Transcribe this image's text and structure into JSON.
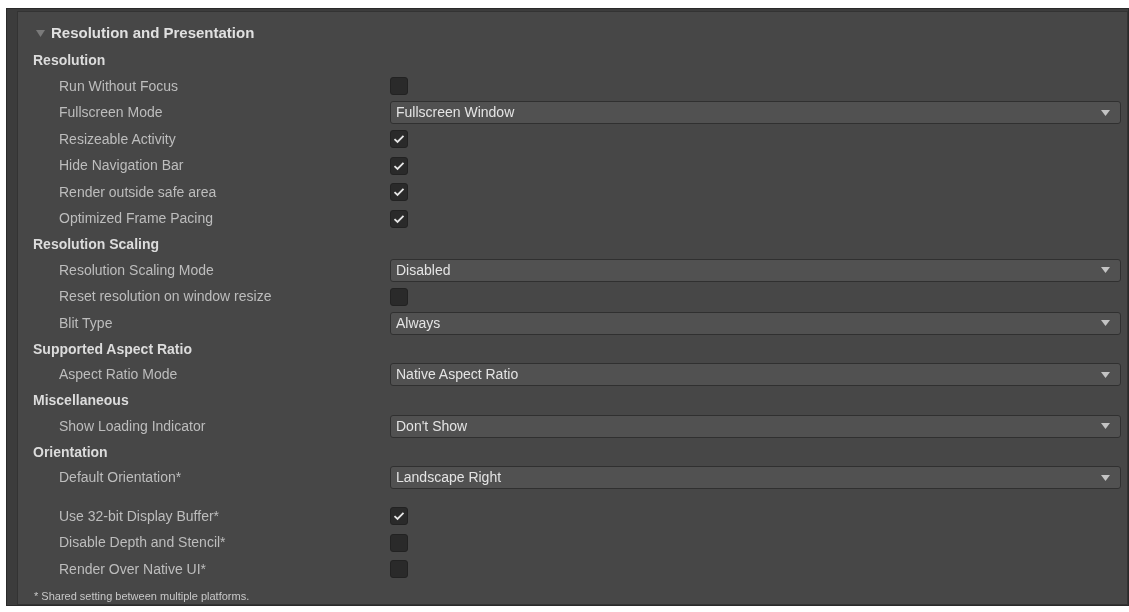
{
  "section": {
    "title": "Resolution and Presentation",
    "expanded": true
  },
  "groups": [
    {
      "title": "Resolution",
      "settings": [
        {
          "label": "Run Without Focus",
          "kind": "checkbox",
          "checked": false
        },
        {
          "label": "Fullscreen Mode",
          "kind": "dropdown",
          "value": "Fullscreen Window"
        },
        {
          "label": "Resizeable Activity",
          "kind": "checkbox",
          "checked": true
        },
        {
          "label": "Hide Navigation Bar",
          "kind": "checkbox",
          "checked": true
        },
        {
          "label": "Render outside safe area",
          "kind": "checkbox",
          "checked": true
        },
        {
          "label": "Optimized Frame Pacing",
          "kind": "checkbox",
          "checked": true
        }
      ]
    },
    {
      "title": "Resolution Scaling",
      "settings": [
        {
          "label": "Resolution Scaling Mode",
          "kind": "dropdown",
          "value": "Disabled"
        },
        {
          "label": "Reset resolution on window resize",
          "kind": "checkbox",
          "checked": false
        },
        {
          "label": "Blit Type",
          "kind": "dropdown",
          "value": "Always"
        }
      ]
    },
    {
      "title": "Supported Aspect Ratio",
      "settings": [
        {
          "label": "Aspect Ratio Mode",
          "kind": "dropdown",
          "value": "Native Aspect Ratio"
        }
      ]
    },
    {
      "title": "Miscellaneous",
      "settings": [
        {
          "label": "Show Loading Indicator",
          "kind": "dropdown",
          "value": "Don't Show"
        }
      ]
    },
    {
      "title": "Orientation",
      "settings": [
        {
          "label": "Default Orientation*",
          "kind": "dropdown",
          "value": "Landscape Right"
        }
      ]
    },
    {
      "settings": [
        {
          "label": "Use 32-bit Display Buffer*",
          "kind": "checkbox",
          "checked": true
        },
        {
          "label": "Disable Depth and Stencil*",
          "kind": "checkbox",
          "checked": false
        },
        {
          "label": "Render Over Native UI*",
          "kind": "checkbox",
          "checked": false
        }
      ]
    }
  ],
  "footnote": "* Shared setting between multiple platforms."
}
